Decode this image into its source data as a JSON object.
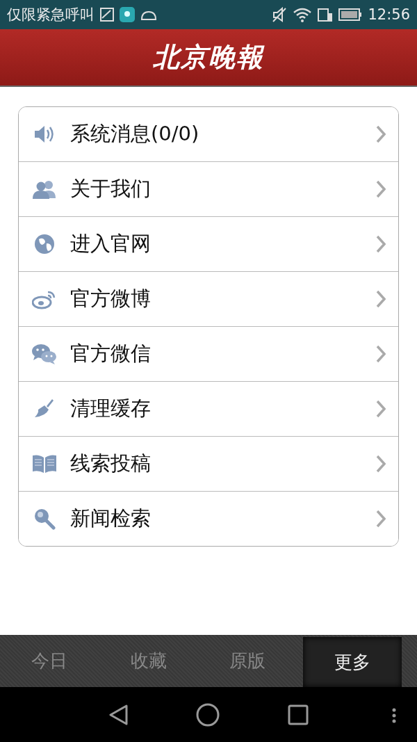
{
  "status_bar": {
    "carrier": "仅限紧急呼叫",
    "time": "12:56"
  },
  "header": {
    "logo": "北京晚報"
  },
  "menu": [
    {
      "kind": "speaker",
      "label": "系统消息(0/0)"
    },
    {
      "kind": "people",
      "label": "关于我们"
    },
    {
      "kind": "globe",
      "label": "进入官网"
    },
    {
      "kind": "weibo",
      "label": "官方微博"
    },
    {
      "kind": "chat",
      "label": "官方微信"
    },
    {
      "kind": "broom",
      "label": "清理缓存"
    },
    {
      "kind": "book",
      "label": "线索投稿"
    },
    {
      "kind": "search",
      "label": "新闻检索"
    }
  ],
  "tabs": [
    {
      "label": "今日",
      "selected": false
    },
    {
      "label": "收藏",
      "selected": false
    },
    {
      "label": "原版",
      "selected": false
    },
    {
      "label": "更多",
      "selected": true
    }
  ]
}
